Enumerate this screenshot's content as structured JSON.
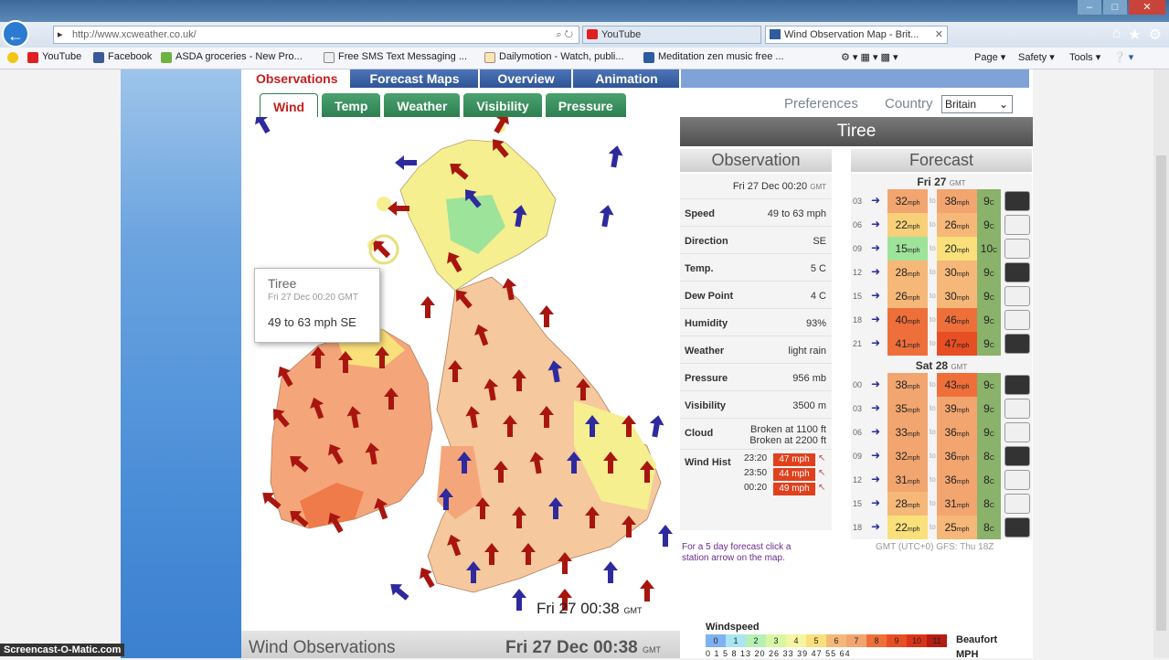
{
  "browser": {
    "url": "http://www.xcweather.co.uk/",
    "tabs": [
      {
        "label": "YouTube"
      },
      {
        "label": "Wind Observation Map - Brit..."
      }
    ],
    "favorites": [
      {
        "label": "YouTube"
      },
      {
        "label": "Facebook"
      },
      {
        "label": "ASDA groceries - New Pro..."
      },
      {
        "label": "Free SMS Text Messaging ..."
      },
      {
        "label": "Dailymotion - Watch, publi..."
      },
      {
        "label": "Meditation zen music free ..."
      }
    ],
    "tools": [
      {
        "label": "Page"
      },
      {
        "label": "Safety"
      },
      {
        "label": "Tools"
      }
    ]
  },
  "site": {
    "main_tabs": [
      {
        "label": "Observations"
      },
      {
        "label": "Forecast Maps"
      },
      {
        "label": "Overview"
      },
      {
        "label": "Animation"
      }
    ],
    "sub_tabs": [
      {
        "label": "Wind"
      },
      {
        "label": "Temp"
      },
      {
        "label": "Weather"
      },
      {
        "label": "Visibility"
      },
      {
        "label": "Pressure"
      }
    ],
    "preferences": "Preferences",
    "country_label": "Country",
    "country_value": "Britain"
  },
  "map": {
    "tooltip": {
      "name": "Tiree",
      "date": "Fri 27 Dec 00:20",
      "gmt": "GMT",
      "value": "49 to 63 mph SE"
    },
    "time_day": "Fri 27",
    "time": "00:38",
    "time_zone": "GMT"
  },
  "station": {
    "name": "Tiree",
    "observation_title": "Observation",
    "observation_date": "Fri 27 Dec 00:20",
    "observation_gmt": "GMT",
    "rows": [
      {
        "key": "Speed",
        "value": "49 to 63 mph"
      },
      {
        "key": "Direction",
        "value": "SE"
      },
      {
        "key": "Temp.",
        "value": "5 C"
      },
      {
        "key": "Dew Point",
        "value": "4 C"
      },
      {
        "key": "Humidity",
        "value": "93%"
      },
      {
        "key": "Weather",
        "value": "light rain"
      },
      {
        "key": "Pressure",
        "value": "956 mb"
      },
      {
        "key": "Visibility",
        "value": "3500 m"
      }
    ],
    "cloud_key": "Cloud",
    "cloud_value_1": "Broken at 1100 ft",
    "cloud_value_2": "Broken at 2200 ft",
    "wind_hist_key": "Wind Hist",
    "wind_hist": [
      {
        "time": "23:20",
        "value": "47 mph"
      },
      {
        "time": "23:50",
        "value": "44 mph"
      },
      {
        "time": "00:20",
        "value": "49 mph"
      }
    ],
    "note": "For a 5 day forecast click a station arrow on the map.",
    "forecast_title": "Forecast",
    "forecast_footer": "GMT (UTC+0) GFS: Thu 18Z",
    "forecast_days": [
      {
        "label": "Fri 27",
        "zone": "GMT",
        "rows": [
          {
            "hour": "03",
            "low": "32",
            "high": "38",
            "temp": "9",
            "low_color": "#f2a56f",
            "high_color": "#f2a56f"
          },
          {
            "hour": "06",
            "low": "22",
            "high": "26",
            "temp": "9",
            "low_color": "#f9d07a",
            "high_color": "#f6b878"
          },
          {
            "hour": "09",
            "low": "15",
            "high": "20",
            "temp": "10",
            "low_color": "#9ee39a",
            "high_color": "#f9e07a"
          },
          {
            "hour": "12",
            "low": "28",
            "high": "30",
            "temp": "9",
            "low_color": "#f6b878",
            "high_color": "#f6b878"
          },
          {
            "hour": "15",
            "low": "26",
            "high": "30",
            "temp": "9",
            "low_color": "#f6b878",
            "high_color": "#f6b878"
          },
          {
            "hour": "18",
            "low": "40",
            "high": "46",
            "temp": "9",
            "low_color": "#ef6f3a",
            "high_color": "#ef6f3a"
          },
          {
            "hour": "21",
            "low": "41",
            "high": "47",
            "temp": "9",
            "low_color": "#ef6f3a",
            "high_color": "#e84e23"
          }
        ]
      },
      {
        "label": "Sat 28",
        "zone": "GMT",
        "rows": [
          {
            "hour": "00",
            "low": "38",
            "high": "43",
            "temp": "9",
            "low_color": "#f2a56f",
            "high_color": "#ef6f3a"
          },
          {
            "hour": "03",
            "low": "35",
            "high": "39",
            "temp": "9",
            "low_color": "#f2a56f",
            "high_color": "#f2a56f"
          },
          {
            "hour": "06",
            "low": "33",
            "high": "36",
            "temp": "9",
            "low_color": "#f2a56f",
            "high_color": "#f2a56f"
          },
          {
            "hour": "09",
            "low": "32",
            "high": "36",
            "temp": "8",
            "low_color": "#f2a56f",
            "high_color": "#f2a56f"
          },
          {
            "hour": "12",
            "low": "31",
            "high": "36",
            "temp": "8",
            "low_color": "#f2a56f",
            "high_color": "#f2a56f"
          },
          {
            "hour": "15",
            "low": "28",
            "high": "31",
            "temp": "8",
            "low_color": "#f6b878",
            "high_color": "#f2a56f"
          },
          {
            "hour": "18",
            "low": "22",
            "high": "25",
            "temp": "8",
            "low_color": "#f9e07a",
            "high_color": "#f6b878"
          }
        ]
      }
    ],
    "unit_mph": "mph",
    "unit_to": "to",
    "unit_c": "C"
  },
  "legend": {
    "title": "Windspeed",
    "beaufort_label": "Beaufort",
    "mph_label": "MPH",
    "scale": [
      "0",
      "1",
      "2",
      "3",
      "4",
      "5",
      "6",
      "7",
      "8",
      "9",
      "10",
      "11"
    ],
    "mph_values": "0 1 5 8 13 20 26 33 39 47 55 64",
    "colors": [
      "#7fb2f0",
      "#a9e6f2",
      "#b6f0b4",
      "#d8f7a3",
      "#f6f5a0",
      "#f9e07a",
      "#f6b878",
      "#f2a56f",
      "#ef6f3a",
      "#e84e23",
      "#d9341a",
      "#b51c12"
    ]
  },
  "footer": {
    "title": "Wind Observations",
    "date": "Fri 27 Dec 00:38",
    "zone": "GMT"
  },
  "watermark": "Screencast-O-Matic.com"
}
